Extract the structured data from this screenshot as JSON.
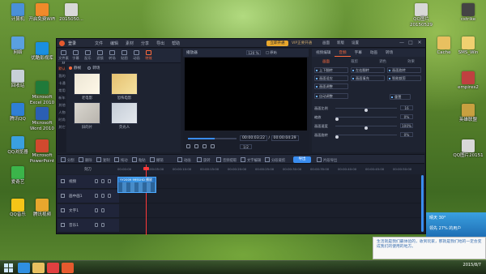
{
  "desktop": {
    "icons": [
      {
        "label": "计算机",
        "color": "#4a90d9"
      },
      {
        "label": "网络",
        "color": "#5aa0e0"
      },
      {
        "label": "回收站",
        "color": "#c8d0d8"
      },
      {
        "label": "腾讯QQ",
        "color": "#2f7fd6"
      },
      {
        "label": "Microsoft Excel 2010",
        "color": "#1f7a3a"
      },
      {
        "label": "QQ浏览器",
        "color": "#3aa0e0"
      },
      {
        "label": "开启免费WiFi",
        "color": "#f08a2a"
      },
      {
        "label": "优酷影视库",
        "color": "#1a8fe0"
      },
      {
        "label": "Microsoft Word 2010",
        "color": "#2b5fb3"
      },
      {
        "label": "Microsoft PowerPoint",
        "color": "#d1492e"
      },
      {
        "label": "爱奇艺",
        "color": "#3bb54a"
      },
      {
        "label": "QQ音乐",
        "color": "#f5c518"
      },
      {
        "label": "腾讯视频",
        "color": "#e8a72d"
      },
      {
        "label": "2015050...",
        "color": "#d8d8d8"
      },
      {
        "label": "QQ图片20150529",
        "color": "#d8d8d8"
      },
      {
        "label": "cstrike",
        "color": "#444"
      },
      {
        "label": "Cache",
        "color": "#e8c060"
      },
      {
        "label": "SMS_Win",
        "color": "#f0d070"
      },
      {
        "label": "empires2",
        "color": "#c04040"
      },
      {
        "label": "英雄联盟",
        "color": "#c8a040"
      },
      {
        "label": "QQ图片20151",
        "color": "#d8d8d8"
      }
    ]
  },
  "taskbar": {
    "clock_time": "2015/8/7",
    "apps": [
      "ie-icon",
      "folder-icon",
      "media-icon",
      "video-editor-icon"
    ]
  },
  "weather": {
    "line1": "晴天 30°",
    "line2": "领先 27% 的用户"
  },
  "notification": {
    "text": "生活就是我们最体验的，收到玩家，那就是我们地的一定会变成我们的使用的地方。"
  },
  "editor": {
    "title": "登录",
    "menu": [
      "文件",
      "编辑",
      "素材",
      "分享",
      "导出",
      "帮助"
    ],
    "vip_button": "立即开通",
    "vip_text": "VIP正要开通",
    "right_menu": [
      "画面",
      "新版",
      "设置"
    ],
    "win_controls": [
      "—",
      "□",
      "✕"
    ],
    "library_tabs": [
      "文件素材",
      "字幕",
      "配乐",
      "滤镜",
      "转场",
      "贴图",
      "动画",
      "特效"
    ],
    "library_side": [
      "默认",
      "我的",
      "卡通",
      "常用",
      "新年",
      "其他",
      "人物",
      "时尚",
      "其它"
    ],
    "radios": [
      "静帧",
      "转场"
    ],
    "thumbs": [
      {
        "label": "老电影"
      },
      {
        "label": "恐怖电影"
      },
      {
        "label": "旧的片"
      },
      {
        "label": "荧光人"
      }
    ],
    "preview": {
      "label": "播放器",
      "zoom": "120 %",
      "ratio": "□ 原始",
      "time_current": "00:00:03:22",
      "time_total": "00:00:04:29",
      "page": "1/2",
      "progress": 0.55
    },
    "props": {
      "tabs": [
        "视频编辑",
        "音频",
        "字幕",
        "动画",
        "转场"
      ],
      "sub_tabs": [
        "画面",
        "裁剪",
        "调色",
        "效果"
      ],
      "buttons": [
        "上下翻转",
        "左右翻转",
        "画面旋转",
        "画面适应",
        "画面填充",
        "智能裁剪",
        "画面调整",
        "自动调整"
      ],
      "reset_label": "重置",
      "rows": [
        {
          "label": "画面比例",
          "value": "16",
          "ratio": 0.5
        },
        {
          "label": "缩放",
          "value": "0%",
          "ratio": 0.0
        },
        {
          "label": "画面速度",
          "value": "100%",
          "ratio": 0.5
        },
        {
          "label": "画面旋转",
          "value": "0%",
          "ratio": 0.0
        }
      ]
    },
    "toolbar": {
      "tools": [
        "分割",
        "删除",
        "复制",
        "拖动",
        "粘贴",
        "撤销",
        "动画",
        "旋转",
        "音频提取",
        "文字编辑",
        "分段裁剪",
        "片段导出"
      ],
      "export_label": "导出"
    },
    "timeline": {
      "reset_label": "刻刀",
      "ticks": [
        "00:00:00",
        "00:00:05:00",
        "00:00:10:00",
        "00:00:15:00",
        "00:00:20:00",
        "00:00:25:00",
        "00:00:30:00",
        "00:00:35:00",
        "00:00:40:00",
        "00:00:45:00",
        "00:00:50:00"
      ],
      "tracks": [
        {
          "name": "视频",
          "icon": "film-icon"
        },
        {
          "name": "画中画1",
          "icon": "pip-icon"
        },
        {
          "name": "文字1",
          "icon": "text-icon"
        },
        {
          "name": "音乐1",
          "icon": "music-icon"
        }
      ],
      "clip_label": "YY2009 9991HD 播放",
      "playhead_position": 0.22
    }
  }
}
